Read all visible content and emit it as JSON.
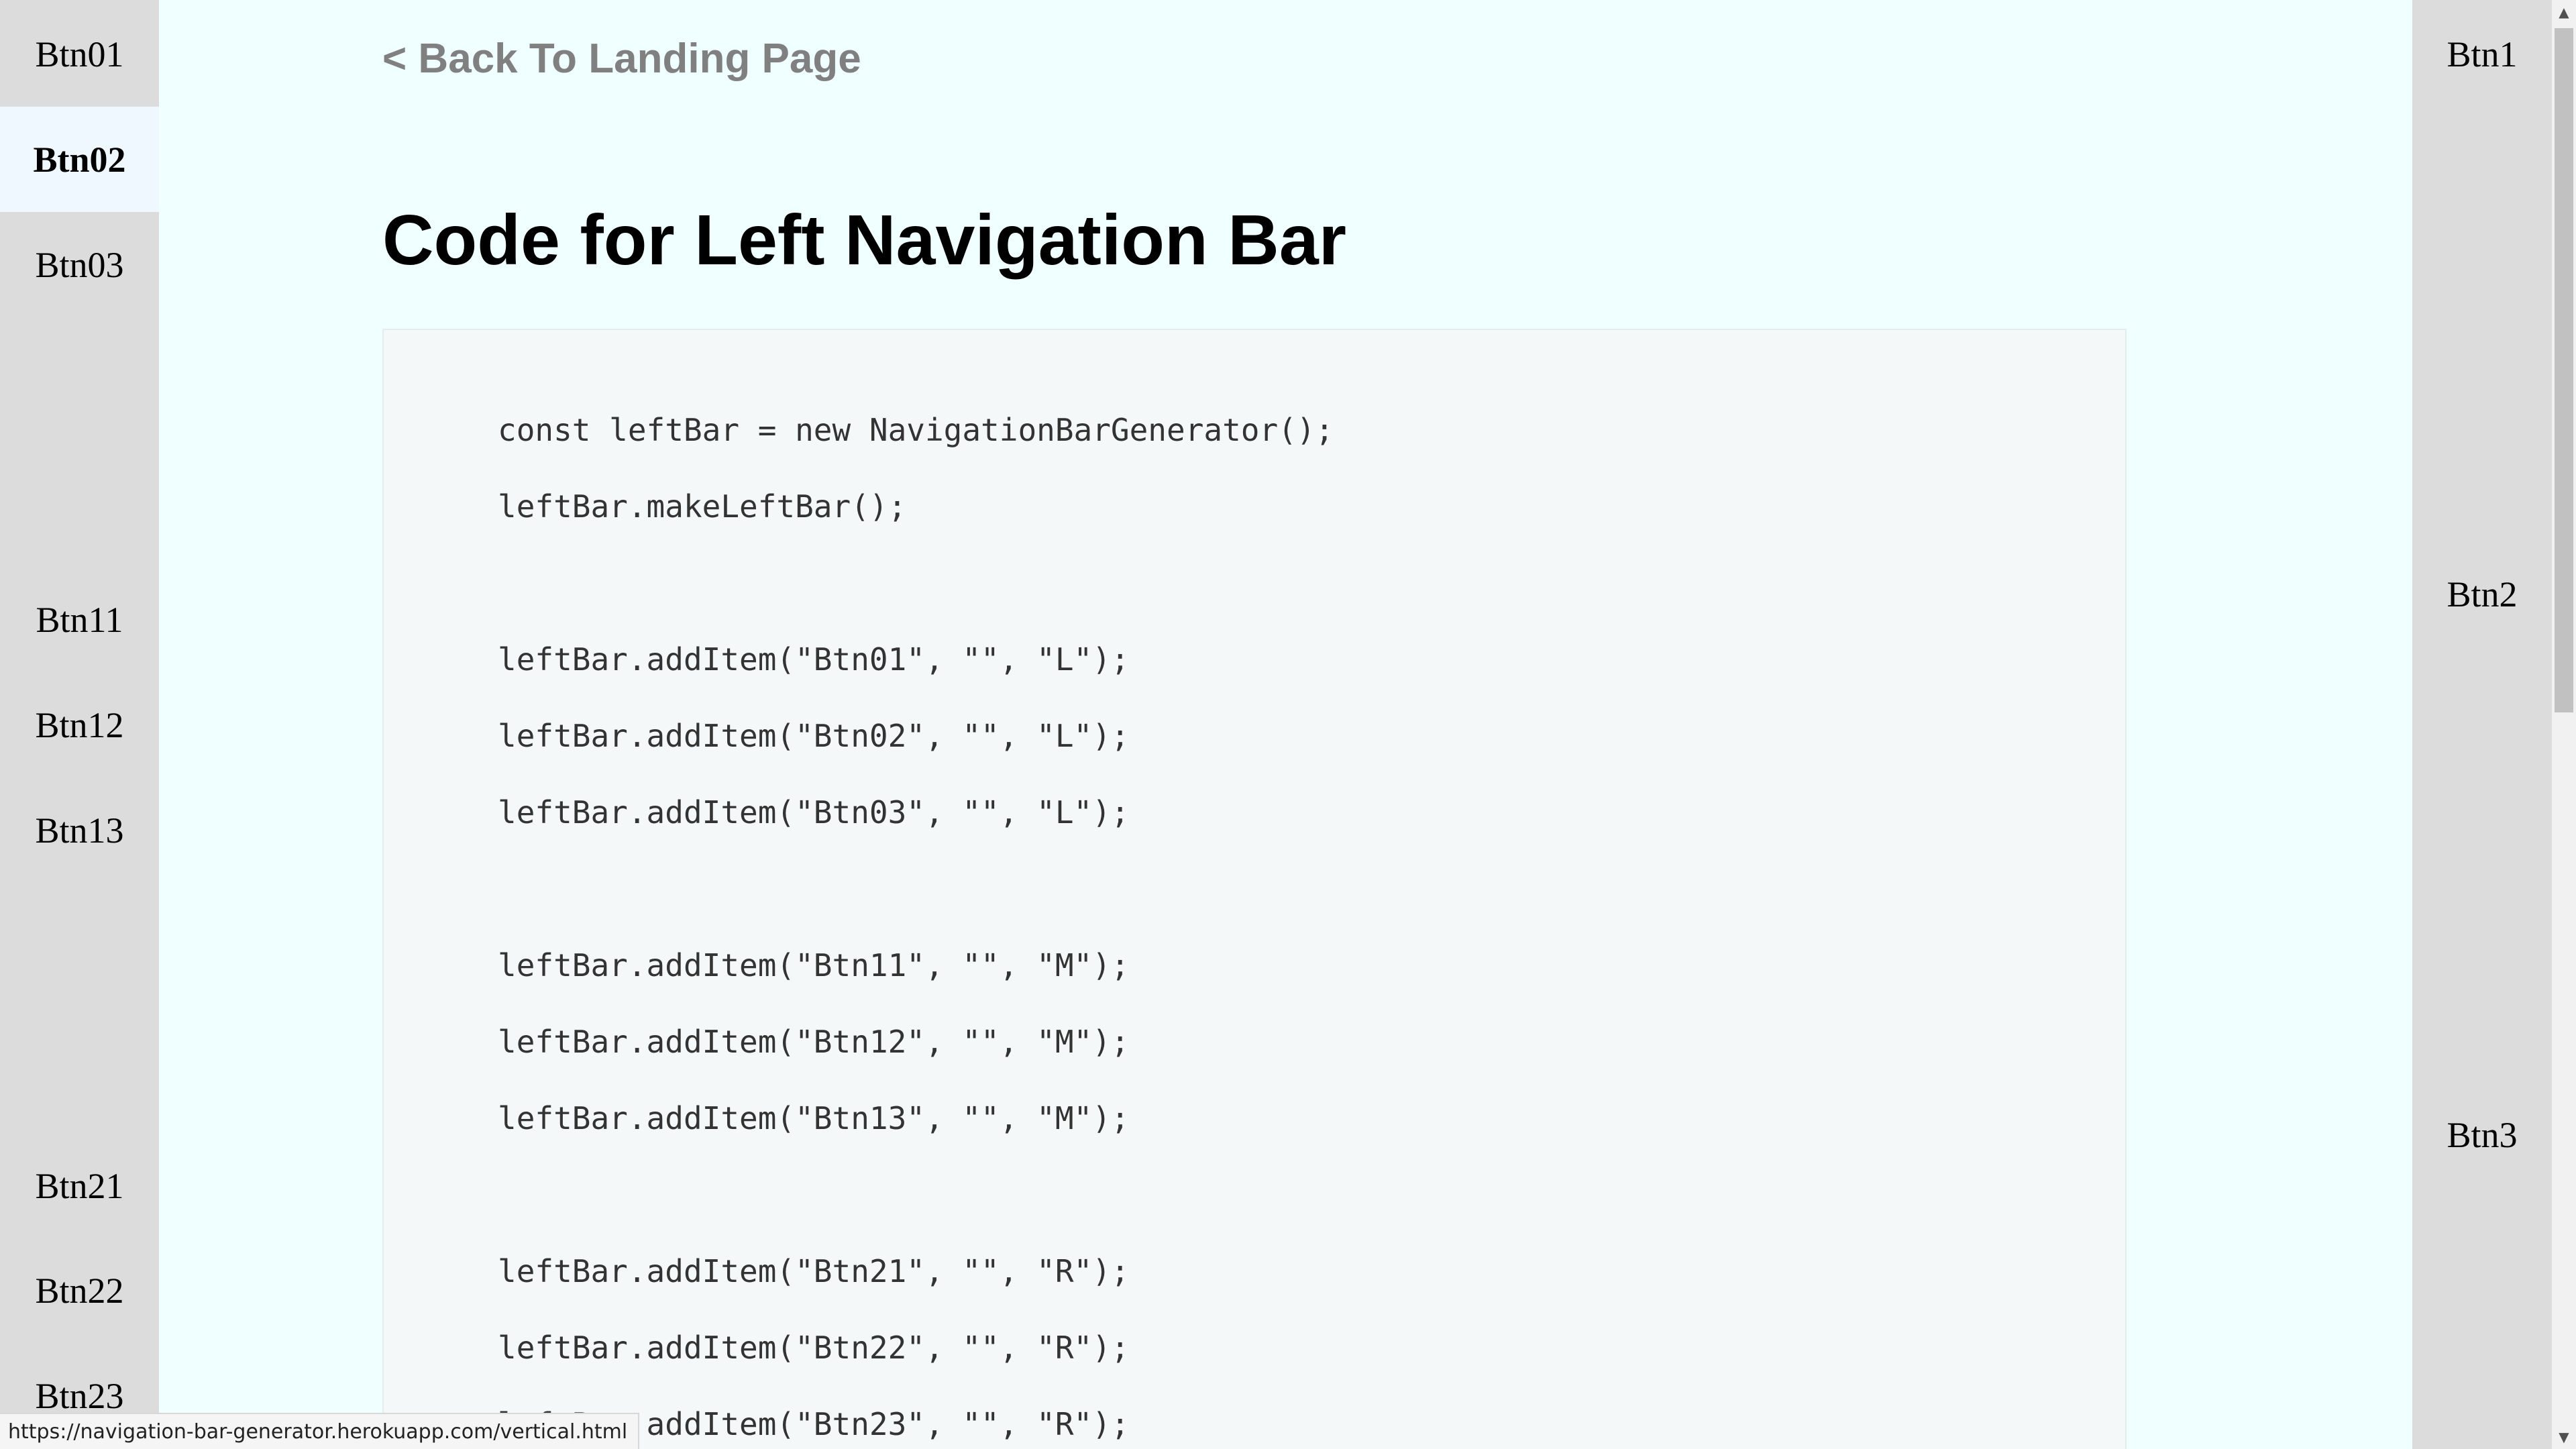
{
  "left_bar": {
    "items": [
      {
        "label": "Btn01",
        "active": false
      },
      {
        "label": "Btn02",
        "active": true
      },
      {
        "label": "Btn03",
        "active": false
      },
      {
        "label": "Btn11",
        "active": false
      },
      {
        "label": "Btn12",
        "active": false
      },
      {
        "label": "Btn13",
        "active": false
      },
      {
        "label": "Btn21",
        "active": false
      },
      {
        "label": "Btn22",
        "active": false
      },
      {
        "label": "Btn23",
        "active": false
      }
    ]
  },
  "right_bar": {
    "items": [
      {
        "label": "Btn1"
      },
      {
        "label": "Btn2"
      },
      {
        "label": "Btn3"
      }
    ]
  },
  "main": {
    "back_link": "< Back To Landing Page",
    "title": "Code for Left Navigation Bar",
    "code_lines": [
      "const leftBar = new NavigationBarGenerator();",
      "leftBar.makeLeftBar();",
      "leftBar.addItem(\"Btn01\", \"\", \"L\");",
      "leftBar.addItem(\"Btn02\", \"\", \"L\");",
      "leftBar.addItem(\"Btn03\", \"\", \"L\");",
      "leftBar.addItem(\"Btn11\", \"\", \"M\");",
      "leftBar.addItem(\"Btn12\", \"\", \"M\");",
      "leftBar.addItem(\"Btn13\", \"\", \"M\");",
      "leftBar.addItem(\"Btn21\", \"\", \"R\");",
      "leftBar.addItem(\"Btn22\", \"\", \"R\");",
      "leftBar.addItem(\"Btn23\", \"\", \"R\");"
    ]
  },
  "status_bar": {
    "url": "https://navigation-bar-generator.herokuapp.com/vertical.html"
  },
  "scrollbar": {
    "up_icon": "triangle-up-icon",
    "down_icon": "triangle-down-icon"
  },
  "colors": {
    "page_background": "#f0ffff",
    "nav_background": "#dcdcdc",
    "active_item_background": "#f0f8ff",
    "back_link": "#808080",
    "code_background": "#f4f8f8"
  }
}
